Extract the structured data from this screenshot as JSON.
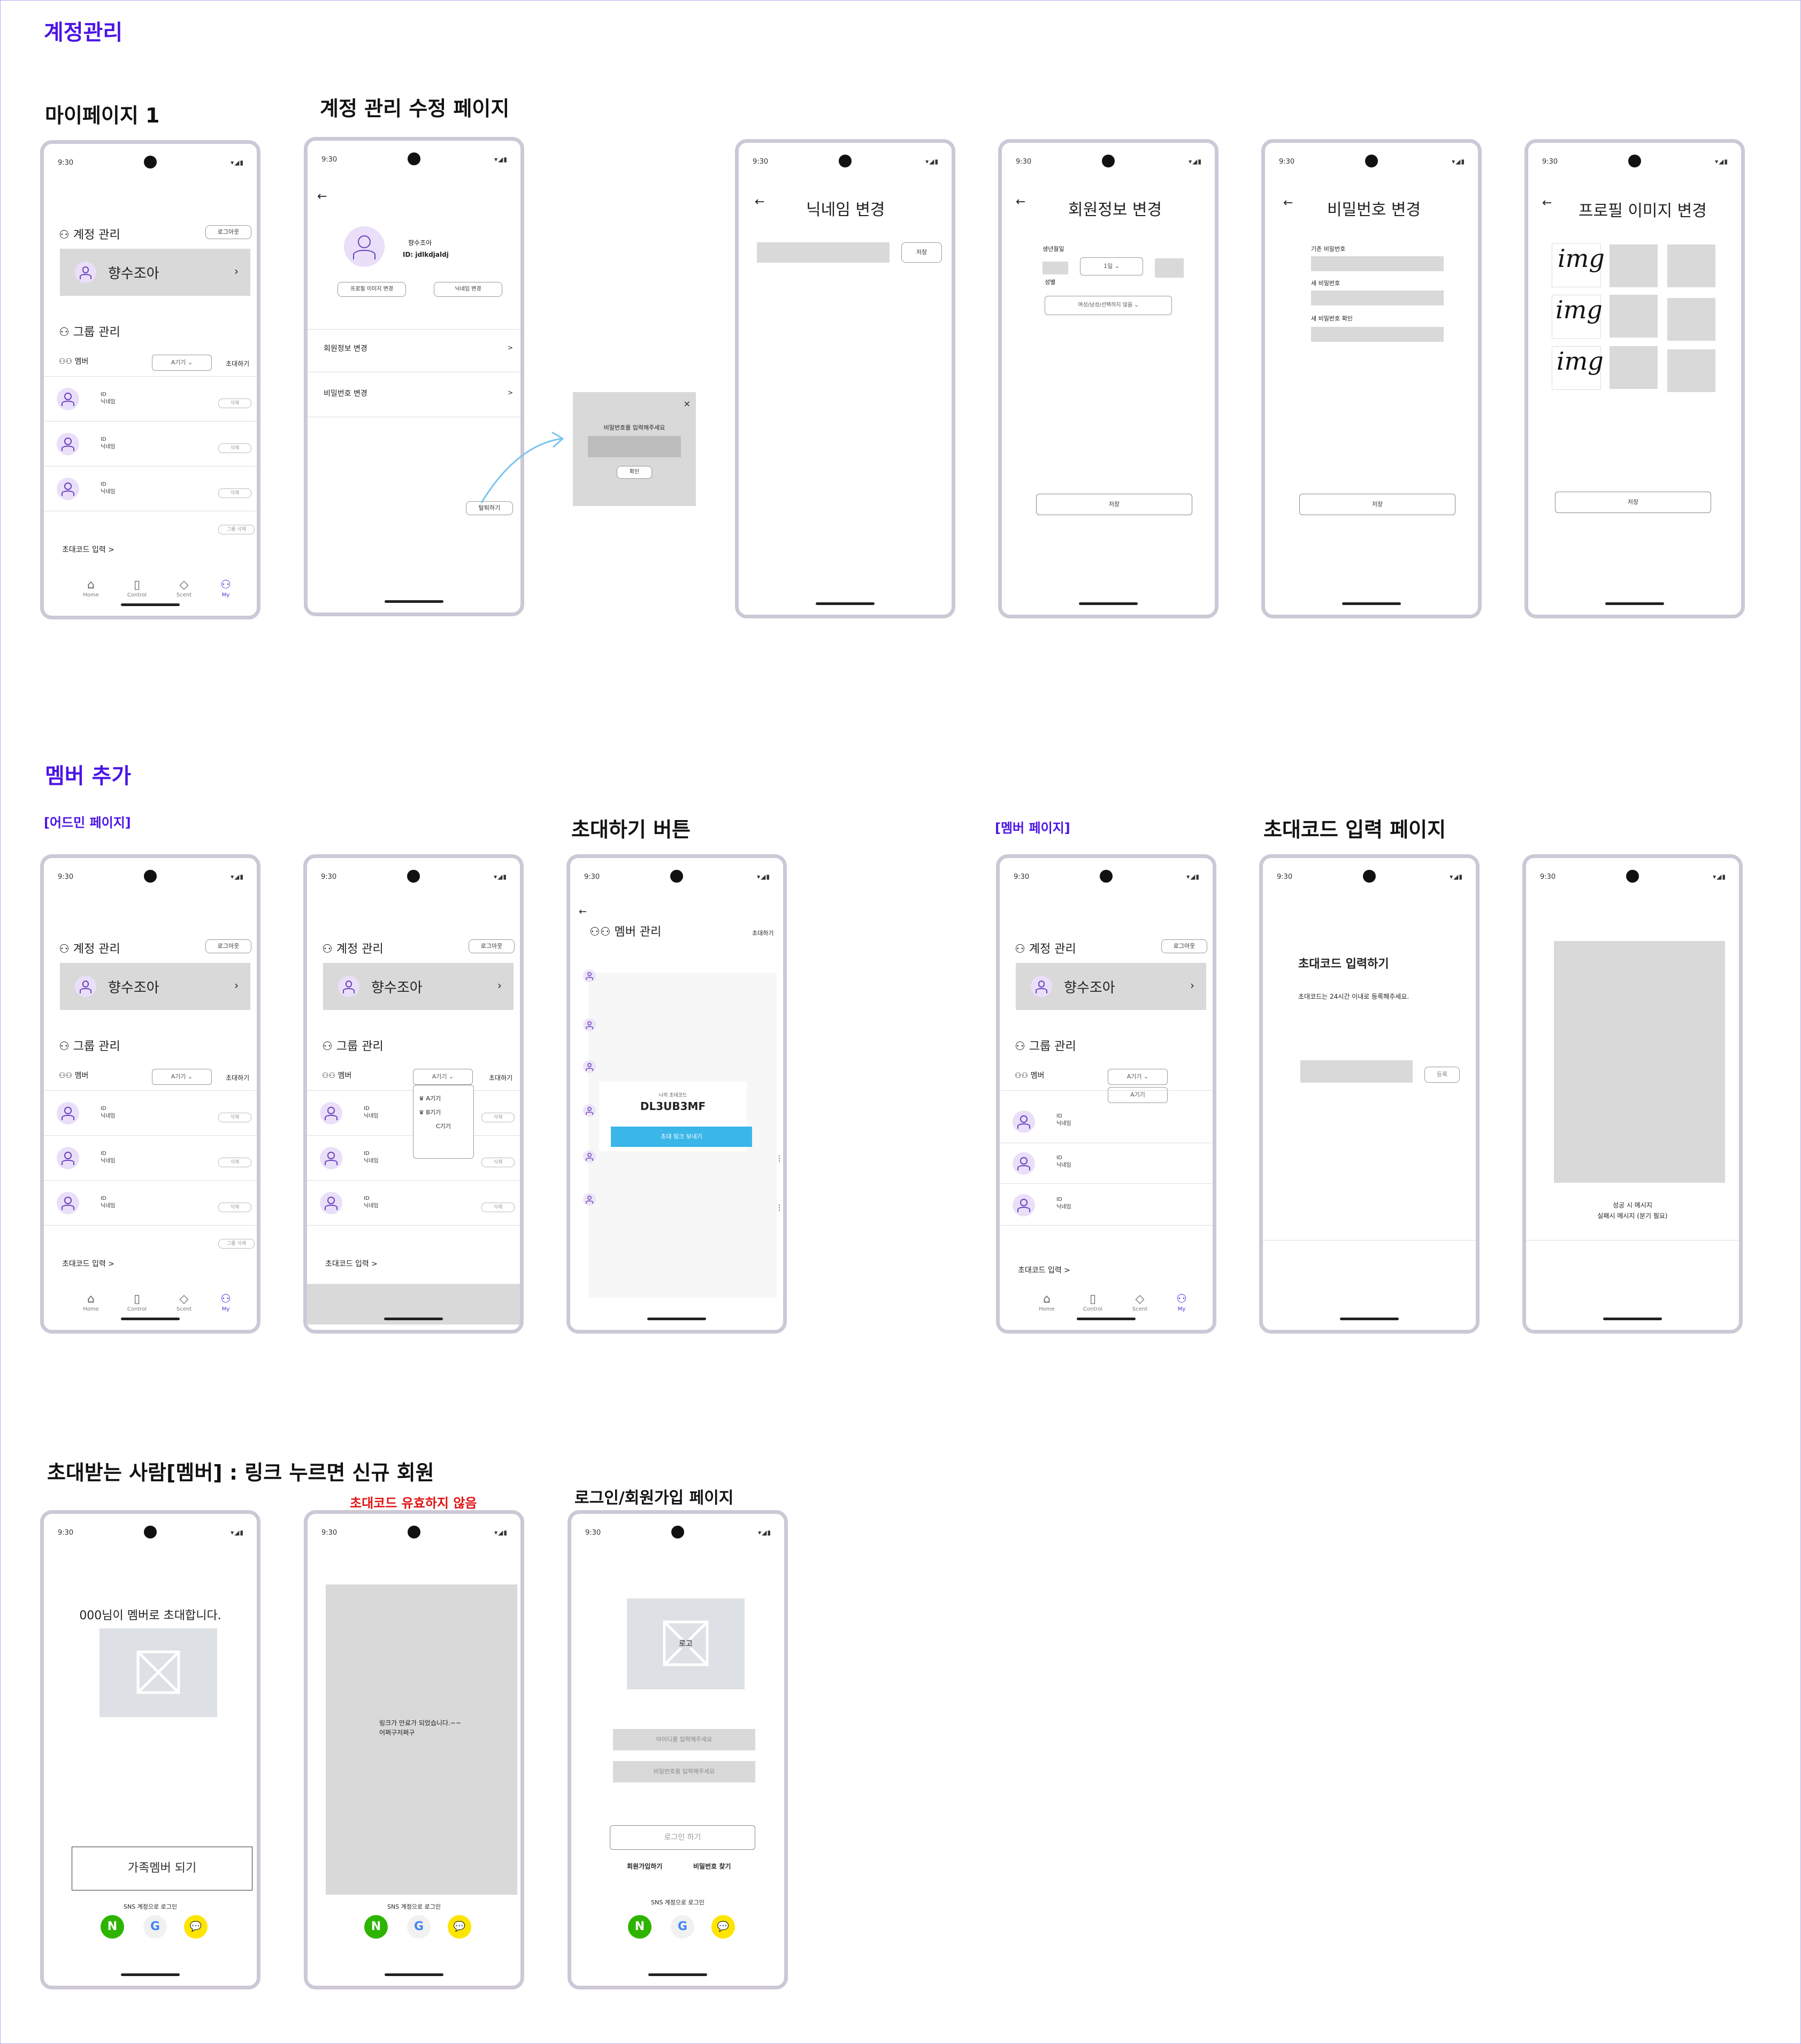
{
  "sections": {
    "account": "계정관리",
    "member_add": "멤버 추가"
  },
  "labels": {
    "mypage1": "마이페이지 1",
    "account_edit": "계정 관리 수정 페이지",
    "admin_page": "[어드민 페이지]",
    "invite_button": "초대하기 버튼",
    "member_page": "[멤버 페이지]",
    "invite_code_page": "초대코드 입력 페이지",
    "invitee": "초대받는 사람[멤버] : 링크 누르면 신규 회원",
    "invalid_code": "초대코드 유효하지 않음",
    "login_page": "로그인/회원가입 페이지"
  },
  "status": {
    "time": "9:30",
    "icons": "▾◢▮"
  },
  "mypage": {
    "account_header": "계정 관리",
    "logout": "로그아웃",
    "profile_name": "향수조아",
    "group_header": "그룹 관리",
    "member_label": "멤버",
    "device_select": "A기기",
    "invite": "초대하기",
    "row_id": "ID",
    "row_nick": "닉네임",
    "delete": "삭제",
    "group_delete": "그룹 삭제",
    "invite_code_link": "초대코드 입력 >",
    "dropdown_options": [
      "A기기",
      "B기기",
      "C기기"
    ],
    "tabs": [
      "Home",
      "Control",
      "Scent",
      "My"
    ]
  },
  "edit": {
    "name": "향수조아",
    "id": "ID: jdlkdjaldj",
    "change_photo": "프로필 이미지 변경",
    "change_nick": "닉네임 변경",
    "member_info": "회원정보 변경",
    "password": "비밀번호 변경",
    "withdraw": "탈퇴하기",
    "chevron": ">"
  },
  "popup": {
    "prompt": "비밀번호를 입력해주세요",
    "confirm": "확인",
    "close": "×"
  },
  "nickname_page": {
    "title": "닉네임 변경",
    "save": "저장"
  },
  "info_page": {
    "title": "회원정보 변경",
    "birth": "생년월일",
    "day": "1일",
    "gender": "성별",
    "gender_select": "여성/남성/선택하지 않음",
    "save": "저장"
  },
  "password_page": {
    "title": "비밀번호 변경",
    "current": "기존 비밀번호",
    "new": "새 비밀번호",
    "confirm": "새 비밀번호 확인",
    "save": "저장"
  },
  "photo_page": {
    "title": "프로필 이미지 변경",
    "img": "img",
    "save": "저장"
  },
  "invite_sheet": {
    "title": "멤버 관리",
    "invite": "초대하기",
    "code_label": "나의 초대코드",
    "code": "DL3UB3MF",
    "send": "초대 링크 보내기"
  },
  "code_entry": {
    "title": "초대코드 입력하기",
    "desc": "초대코드는 24시간 이내로 등록해주세요.",
    "register": "등록"
  },
  "result_page": {
    "line1": "성공 시 메시지",
    "line2": "실패시 메시지 (분기 필요)"
  },
  "invitee_page": {
    "message": "000님이 멤버로 초대합니다.",
    "join": "가족멤버 되기",
    "sns": "SNS 계정으로 로그인"
  },
  "expired_page": {
    "line1": "링크가 만료가 되었습니다.~~",
    "line2": "어쩌구저쩌구",
    "sns": "SNS 계정으로 로그인"
  },
  "login": {
    "logo": "로고",
    "id_ph": "아이디를 입력해주세요",
    "pw_ph": "비밀번호를 입력해주세요",
    "login": "로그인 하기",
    "signup": "회원가입하기",
    "find_pw": "비밀번호 찾기",
    "sns": "SNS 계정으로 로그인"
  },
  "sns_icons": {
    "naver": "N",
    "google": "G",
    "kakao": "💬"
  },
  "colors": {
    "accent": "#4b14e6",
    "warn": "#e01010",
    "send": "#3bb6e8",
    "avatar": "#eadff8"
  }
}
